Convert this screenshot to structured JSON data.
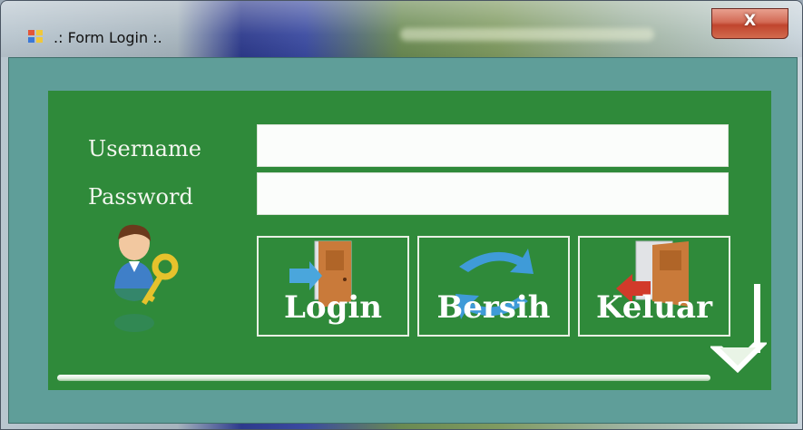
{
  "window": {
    "title": ".: Form Login :.",
    "close_label": "X"
  },
  "form": {
    "username_label": "Username",
    "password_label": "Password",
    "username_value": "",
    "password_value": ""
  },
  "buttons": {
    "login_label": "Login",
    "clear_label": "Bersih",
    "exit_label": "Keluar"
  },
  "icons": {
    "app": "app-window-icon",
    "user": "user-key-icon",
    "login": "door-enter-icon",
    "clear": "refresh-arrows-icon",
    "exit": "door-exit-icon",
    "down": "down-arrow-icon"
  },
  "colors": {
    "panel": "#2f8a3a",
    "frame": "#5f9e99",
    "text": "#ffffff"
  }
}
